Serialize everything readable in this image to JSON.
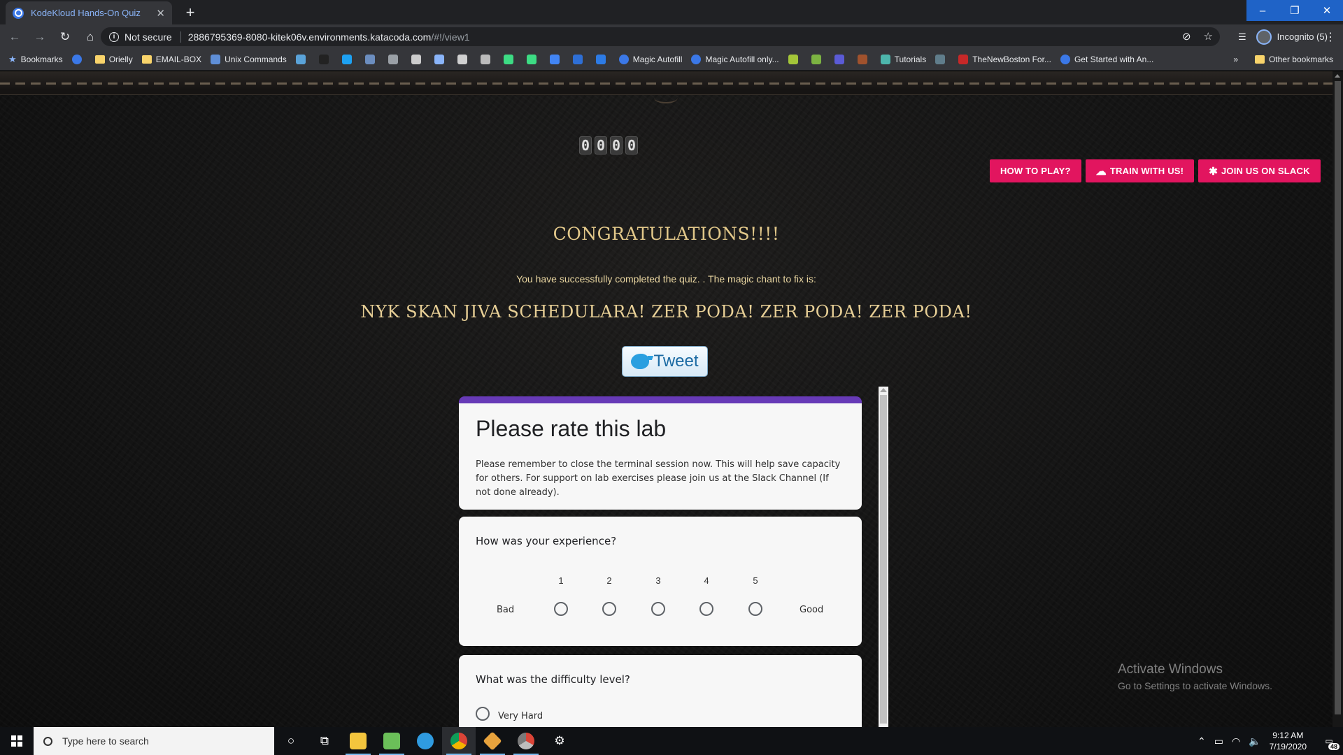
{
  "browser": {
    "tab_title": "KodeKloud Hands-On Quiz",
    "security_label": "Not secure",
    "url_host": "2886795369-8080-kitek06v.environments.katacoda.com",
    "url_path": "/#!/view1",
    "profile_label": "Incognito (5)",
    "bookmarks": [
      {
        "label": "Bookmarks",
        "icon": "star-icon"
      },
      {
        "label": "",
        "icon": "globe-icon",
        "color": "#3b78e7"
      },
      {
        "label": "Orielly",
        "icon": "folder-icon"
      },
      {
        "label": "EMAIL-BOX",
        "icon": "folder-icon"
      },
      {
        "label": "Unix Commands",
        "icon": "terminal-icon",
        "color": "#5f8fd8"
      },
      {
        "label": "",
        "icon": "app-icon",
        "color": "#5aa3d9"
      },
      {
        "label": "",
        "icon": "app-icon",
        "color": "#222222"
      },
      {
        "label": "",
        "icon": "twitter-icon",
        "color": "#1da1f2"
      },
      {
        "label": "",
        "icon": "app-icon",
        "color": "#6c8ebf"
      },
      {
        "label": "",
        "icon": "app-icon",
        "color": "#9aa0a6"
      },
      {
        "label": "",
        "icon": "wordpress-icon",
        "color": "#cccccc"
      },
      {
        "label": "",
        "icon": "app-icon",
        "color": "#8ab4f8"
      },
      {
        "label": "",
        "icon": "app-icon",
        "color": "#d0d0d0"
      },
      {
        "label": "",
        "icon": "app-icon",
        "color": "#bbbbbb"
      },
      {
        "label": "",
        "icon": "android-icon",
        "color": "#3ddc84"
      },
      {
        "label": "",
        "icon": "android-icon",
        "color": "#3ddc84"
      },
      {
        "label": "",
        "icon": "app-icon",
        "color": "#4285f4"
      },
      {
        "label": "",
        "icon": "app-icon",
        "color": "#2e6fd6"
      },
      {
        "label": "",
        "icon": "app-icon",
        "color": "#2d7be5"
      },
      {
        "label": "Magic Autofill",
        "icon": "globe-icon",
        "color": "#3b78e7"
      },
      {
        "label": "Magic Autofill only...",
        "icon": "globe-icon",
        "color": "#3b78e7"
      },
      {
        "label": "",
        "icon": "help-icon",
        "color": "#a4c639"
      },
      {
        "label": "",
        "icon": "app-icon",
        "color": "#7cb342"
      },
      {
        "label": "",
        "icon": "app-icon",
        "color": "#5b5bd6"
      },
      {
        "label": "",
        "icon": "app-icon",
        "color": "#a0522d"
      },
      {
        "label": "Tutorials",
        "icon": "app-icon",
        "color": "#4db6ac"
      },
      {
        "label": "",
        "icon": "app-icon",
        "color": "#607d8b"
      },
      {
        "label": "TheNewBoston For...",
        "icon": "app-icon",
        "color": "#c62828"
      },
      {
        "label": "Get Started with An...",
        "icon": "globe-icon",
        "color": "#3b78e7"
      }
    ],
    "other_bookmarks": "Other bookmarks"
  },
  "page": {
    "score_digits": [
      "0",
      "0",
      "0",
      "0"
    ],
    "buttons": {
      "how_to_play": "HOW TO PLAY?",
      "train": "TRAIN WITH US!",
      "slack": "JOIN US ON SLACK"
    },
    "congrats": "CONGRATULATIONS!!!!",
    "completed": "You have successfully completed the quiz. . The magic chant to fix is:",
    "chant": "NYK SKAN JIVA SCHEDULARA! ZER PODA! ZER PODA! ZER PODA!",
    "tweet": "Tweet"
  },
  "form": {
    "title": "Please rate this lab",
    "description": "Please remember to close the terminal session now. This will help save capacity for others. For support on lab exercises please join us at the Slack Channel (If not done already).",
    "q1": {
      "title": "How was your experience?",
      "scale": [
        "1",
        "2",
        "3",
        "4",
        "5"
      ],
      "low_label": "Bad",
      "high_label": "Good"
    },
    "q2": {
      "title": "What was the difficulty level?",
      "options": [
        "Very Hard"
      ]
    }
  },
  "watermark": {
    "line1": "Activate Windows",
    "line2": "Go to Settings to activate Windows."
  },
  "taskbar": {
    "search_placeholder": "Type here to search",
    "time": "9:12 AM",
    "date": "7/19/2020",
    "notifications": "48"
  }
}
